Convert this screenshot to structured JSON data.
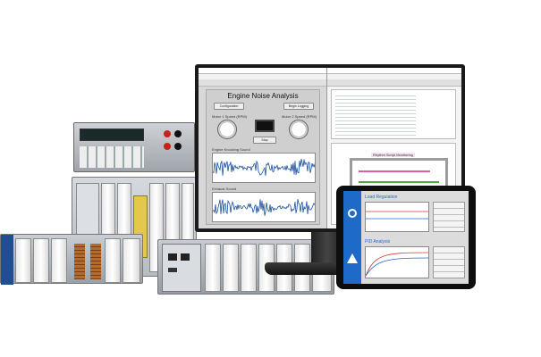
{
  "monitor": {
    "left_window": {
      "title": "Engine Noise Analysis",
      "buttons": {
        "configuration": "Configuration",
        "begin_logging": "Begin Logging",
        "stop": "Stop"
      },
      "gauge_labels": {
        "left": "Motor 1 Speed (RPM)",
        "right": "Motor 2 Speed (RPM)"
      },
      "graph_labels": {
        "top": "Engine Knocking Sound",
        "bottom": "Exhaust Sound"
      }
    },
    "right_window": {
      "node": "Rhythm Script Monitoring"
    }
  },
  "tablet": {
    "panel_top_title": "Load Regulation",
    "panel_bottom_title": "PID Analysis"
  },
  "colors": {
    "accent": "#1e6ac8",
    "graph_signal": "#1b4f9c",
    "lv_wire_pink": "#e05aa8",
    "lv_wire_green": "#4fa844",
    "ni_blue": "#1f4f91"
  }
}
